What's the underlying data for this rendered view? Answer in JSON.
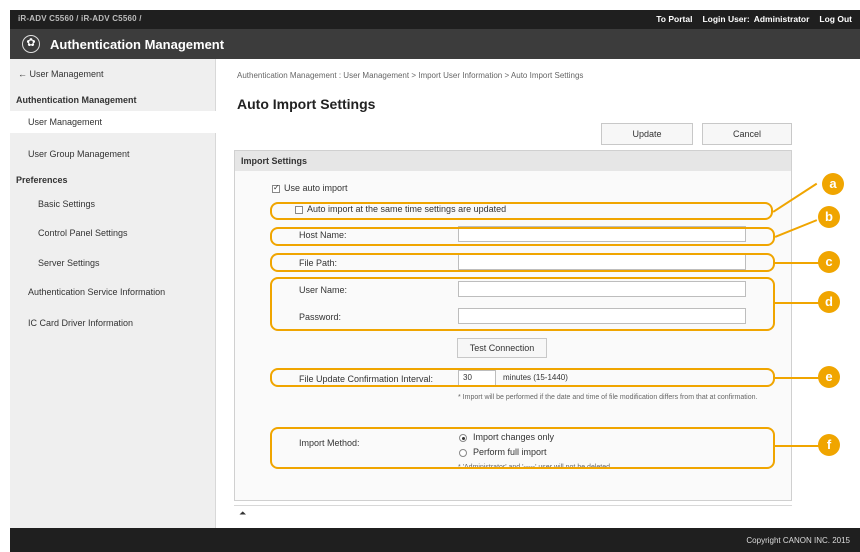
{
  "header": {
    "device_name": "iR-ADV C5560 / iR-ADV C5560 /",
    "to_portal": "To Portal",
    "login_user_label": "Login User:",
    "login_user_name": "Administrator",
    "logout": "Log Out",
    "app_title": "Authentication Management"
  },
  "sidebar": {
    "back": "User Management",
    "section": "Authentication Management",
    "items": [
      {
        "label": "User Management",
        "selected": true
      },
      {
        "label": "User Group Management"
      }
    ],
    "preferences_label": "Preferences",
    "preferences": [
      "Basic Settings",
      "Control Panel Settings",
      "Server Settings"
    ],
    "other": [
      "Authentication Service Information",
      "IC Card Driver Information"
    ]
  },
  "main": {
    "breadcrumb": "Authentication Management : User Management > Import User Information > Auto Import Settings",
    "title": "Auto Import Settings",
    "update_label": "Update",
    "cancel_label": "Cancel",
    "panel_title": "Import Settings",
    "use_auto_import": "Use auto import",
    "auto_import_same_time": "Auto import at the same time settings are updated",
    "host_name_label": "Host Name:",
    "host_name_value": "",
    "file_path_label": "File Path:",
    "file_path_value": "",
    "user_name_label": "User Name:",
    "user_name_value": "",
    "password_label": "Password:",
    "password_value": "",
    "test_connection": "Test Connection",
    "interval_label": "File Update Confirmation Interval:",
    "interval_value": "30",
    "interval_unit": "minutes (15-1440)",
    "interval_note": "* Import will be performed if the date and time of file modification differs from that at confirmation.",
    "import_method_label": "Import Method:",
    "import_changes_only": "Import changes only",
    "perform_full_import": "Perform full import",
    "method_note": "* 'Administrator' and '-----' user will not be deleted.",
    "to_top": "⏶"
  },
  "callouts": [
    "a",
    "b",
    "c",
    "d",
    "e",
    "f"
  ],
  "colors": {
    "accent": "#f0a500",
    "topbar": "#1f1f1f",
    "titlebar": "#3c3c3c"
  },
  "footer": {
    "copyright": "Copyright CANON INC. 2015"
  }
}
